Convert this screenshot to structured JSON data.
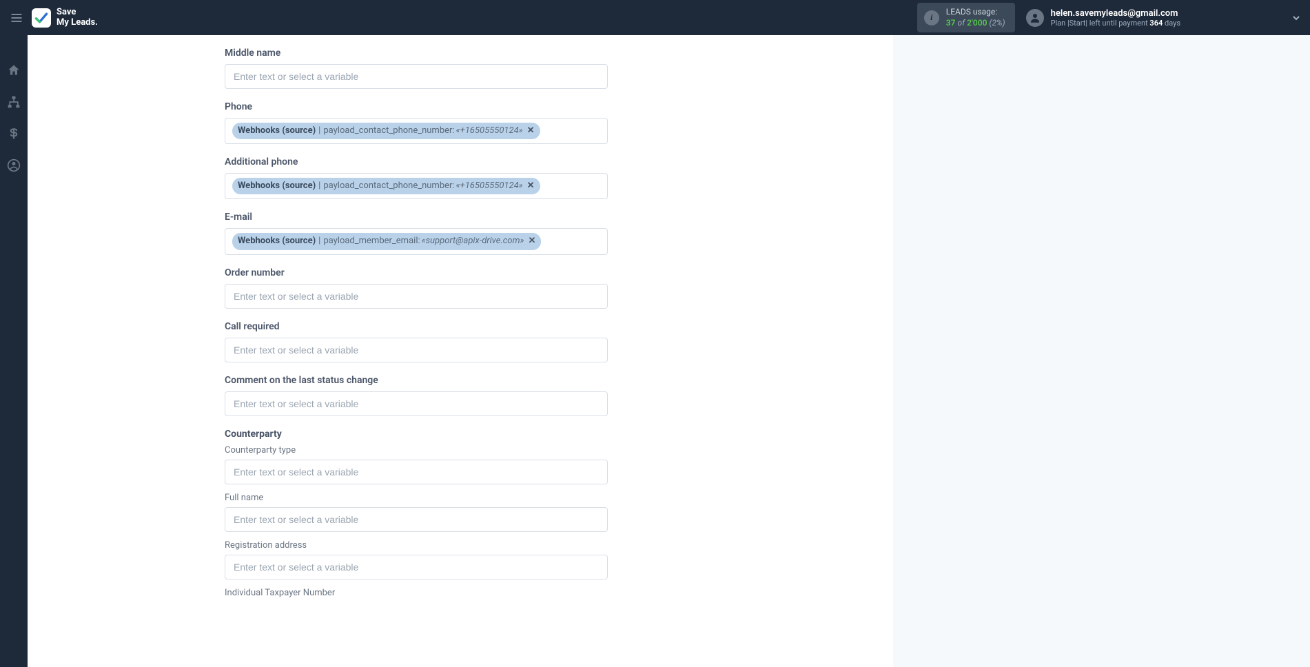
{
  "header": {
    "brand_line1": "Save",
    "brand_line2": "My Leads.",
    "usage": {
      "title": "LEADS usage:",
      "used": "37",
      "of": "of",
      "total": "2'000",
      "pct": "(2%)"
    },
    "account": {
      "email": "helen.savemyleads@gmail.com",
      "plan_prefix": "Plan |Start| left until payment ",
      "days_num": "364",
      "days_suffix": " days"
    }
  },
  "placeholder": "Enter text or select a variable",
  "fields": {
    "middle_name": {
      "label": "Middle name"
    },
    "phone": {
      "label": "Phone",
      "chip": {
        "source": "Webhooks (source)",
        "name": "payload_contact_phone_number:",
        "value": "«+16505550124»"
      }
    },
    "additional_phone": {
      "label": "Additional phone",
      "chip": {
        "source": "Webhooks (source)",
        "name": "payload_contact_phone_number:",
        "value": "«+16505550124»"
      }
    },
    "email": {
      "label": "E-mail",
      "chip": {
        "source": "Webhooks (source)",
        "name": "payload_member_email:",
        "value": "«support@apix-drive.com»"
      }
    },
    "order_number": {
      "label": "Order number"
    },
    "call_required": {
      "label": "Call required"
    },
    "comment_status": {
      "label": "Comment on the last status change"
    },
    "counterparty": {
      "section": "Counterparty",
      "type": "Counterparty type",
      "full_name": "Full name",
      "reg_address": "Registration address",
      "itn": "Individual Taxpayer Number"
    }
  }
}
